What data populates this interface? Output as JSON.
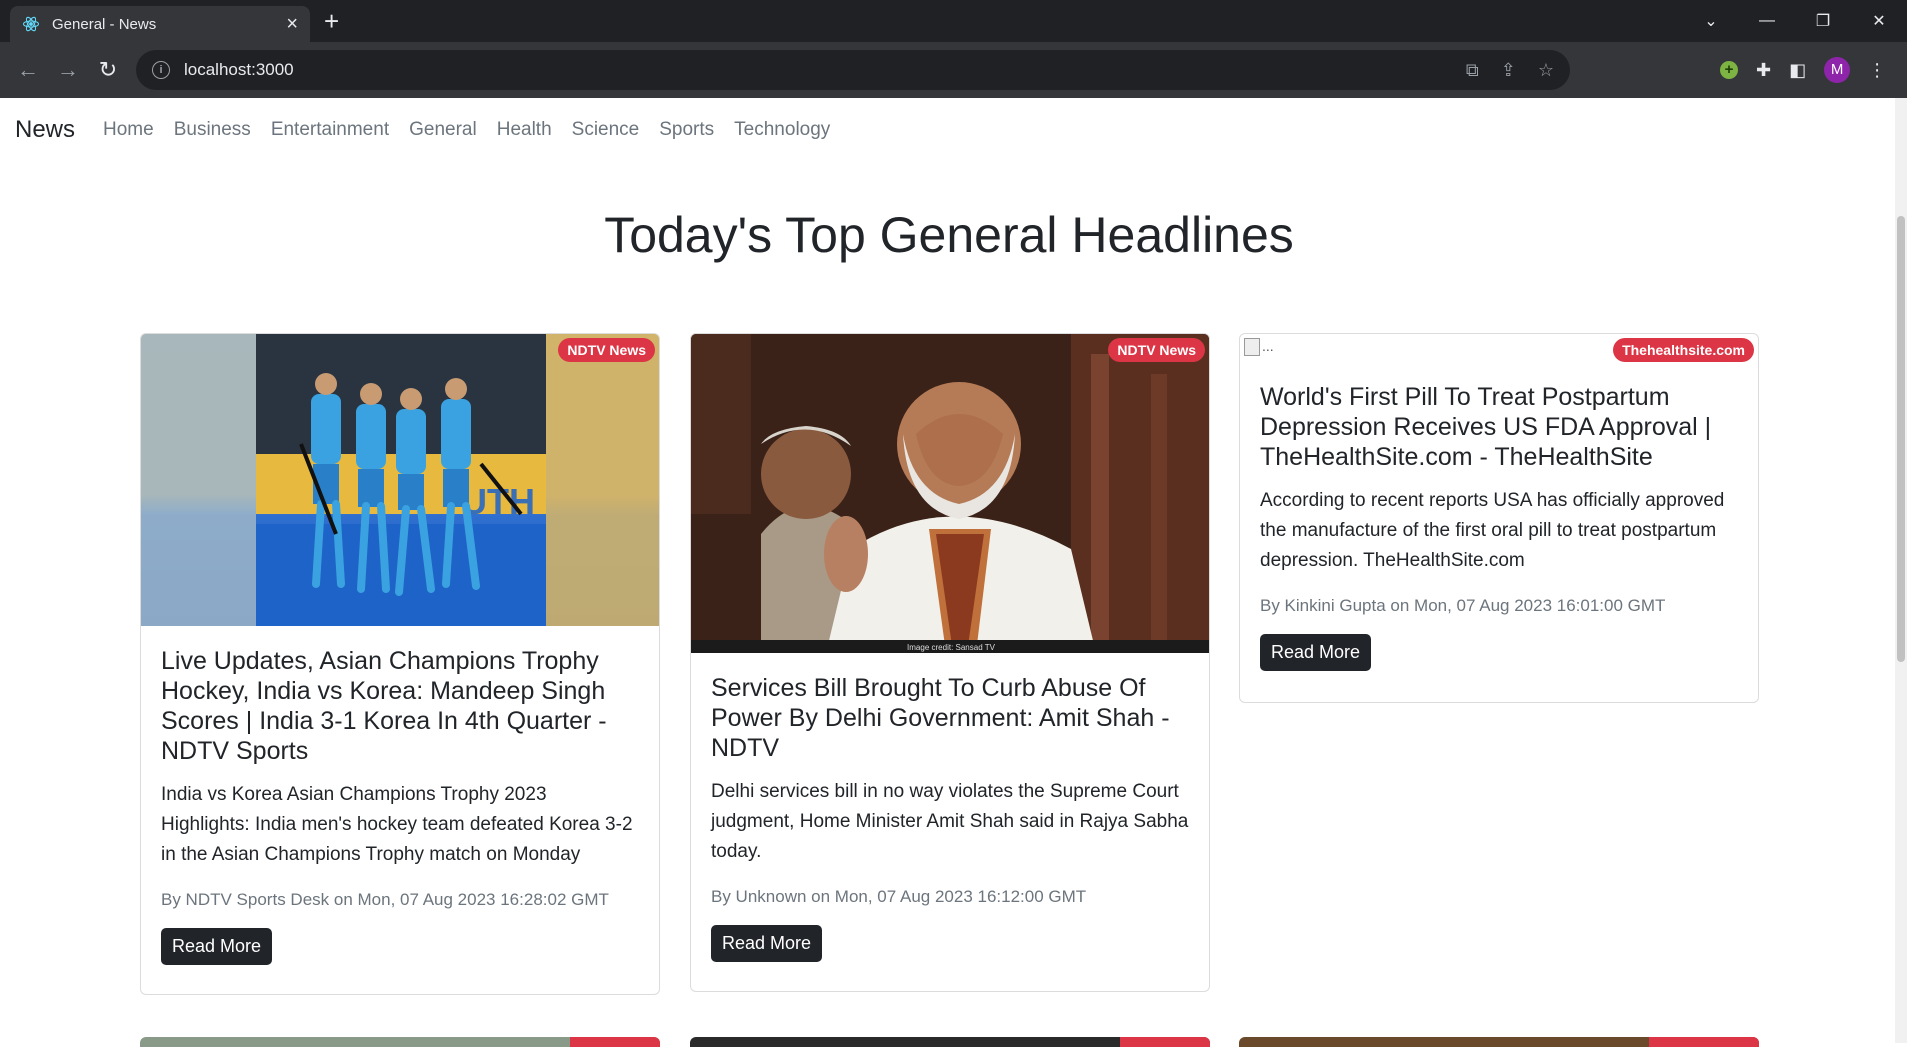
{
  "browser": {
    "tab_title": "General - News",
    "new_tab": "+",
    "url": "localhost:3000",
    "profile_initial": "M"
  },
  "navbar": {
    "brand": "News",
    "links": [
      "Home",
      "Business",
      "Entertainment",
      "General",
      "Health",
      "Science",
      "Sports",
      "Technology"
    ]
  },
  "headline": "Today's Top General Headlines",
  "articles": [
    {
      "source": "NDTV News",
      "title": "Live Updates, Asian Champions Trophy Hockey, India vs Korea: Mandeep Singh Scores | India 3-1 Korea In 4th Quarter - NDTV Sports",
      "description": "India vs Korea Asian Champions Trophy 2023 Highlights: India men's hockey team defeated Korea 3-2 in the Asian Champions Trophy match on Monday",
      "meta": "By NDTV Sports Desk on Mon, 07 Aug 2023 16:28:02 GMT",
      "button": "Read More",
      "image_alt": "",
      "image_text": "UTH"
    },
    {
      "source": "NDTV News",
      "title": "Services Bill Brought To Curb Abuse Of Power By Delhi Government: Amit Shah - NDTV",
      "description": "Delhi services bill in no way violates the Supreme Court judgment, Home Minister Amit Shah said in Rajya Sabha today.",
      "meta": "By Unknown on Mon, 07 Aug 2023 16:12:00 GMT",
      "button": "Read More",
      "image_credit": "Image credit: Sansad TV"
    },
    {
      "source": "Thehealthsite.com",
      "title": "World's First Pill To Treat Postpartum Depression Receives US FDA Approval | TheHealthSite.com - TheHealthSite",
      "description": "According to recent reports USA has officially approved the manufacture of the first oral pill to treat postpartum depression. TheHealthSite.com",
      "meta": "By Kinkini Gupta on Mon, 07 Aug 2023 16:01:00 GMT",
      "button": "Read More",
      "image_alt": "..."
    }
  ],
  "colors": {
    "badge": "#dc3545",
    "button": "#212529",
    "chrome_dark": "#202124",
    "chrome_toolbar": "#35363a"
  }
}
